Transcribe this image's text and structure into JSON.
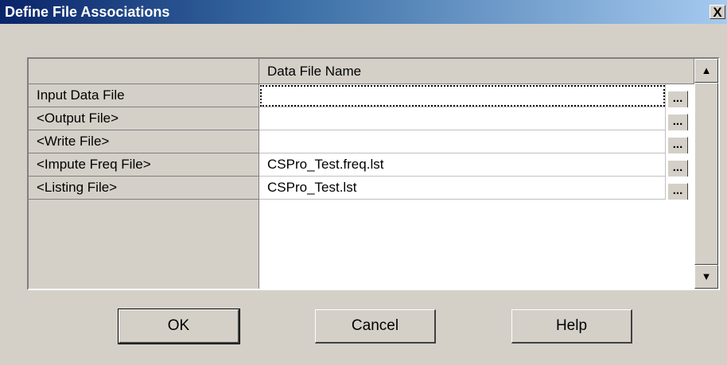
{
  "window": {
    "title": "Define File Associations",
    "close_glyph": "X"
  },
  "grid": {
    "column_header": "Data File Name",
    "rows": [
      {
        "label": "Input Data File",
        "value": "",
        "browse": "..."
      },
      {
        "label": "<Output File>",
        "value": "",
        "browse": "..."
      },
      {
        "label": "<Write File>",
        "value": "",
        "browse": "..."
      },
      {
        "label": "<Impute Freq File>",
        "value": "CSPro_Test.freq.lst",
        "browse": "..."
      },
      {
        "label": "<Listing File>",
        "value": "CSPro_Test.lst",
        "browse": "..."
      }
    ],
    "scroll_up_glyph": "▲",
    "scroll_down_glyph": "▼"
  },
  "buttons": {
    "ok": "OK",
    "cancel": "Cancel",
    "help": "Help"
  }
}
